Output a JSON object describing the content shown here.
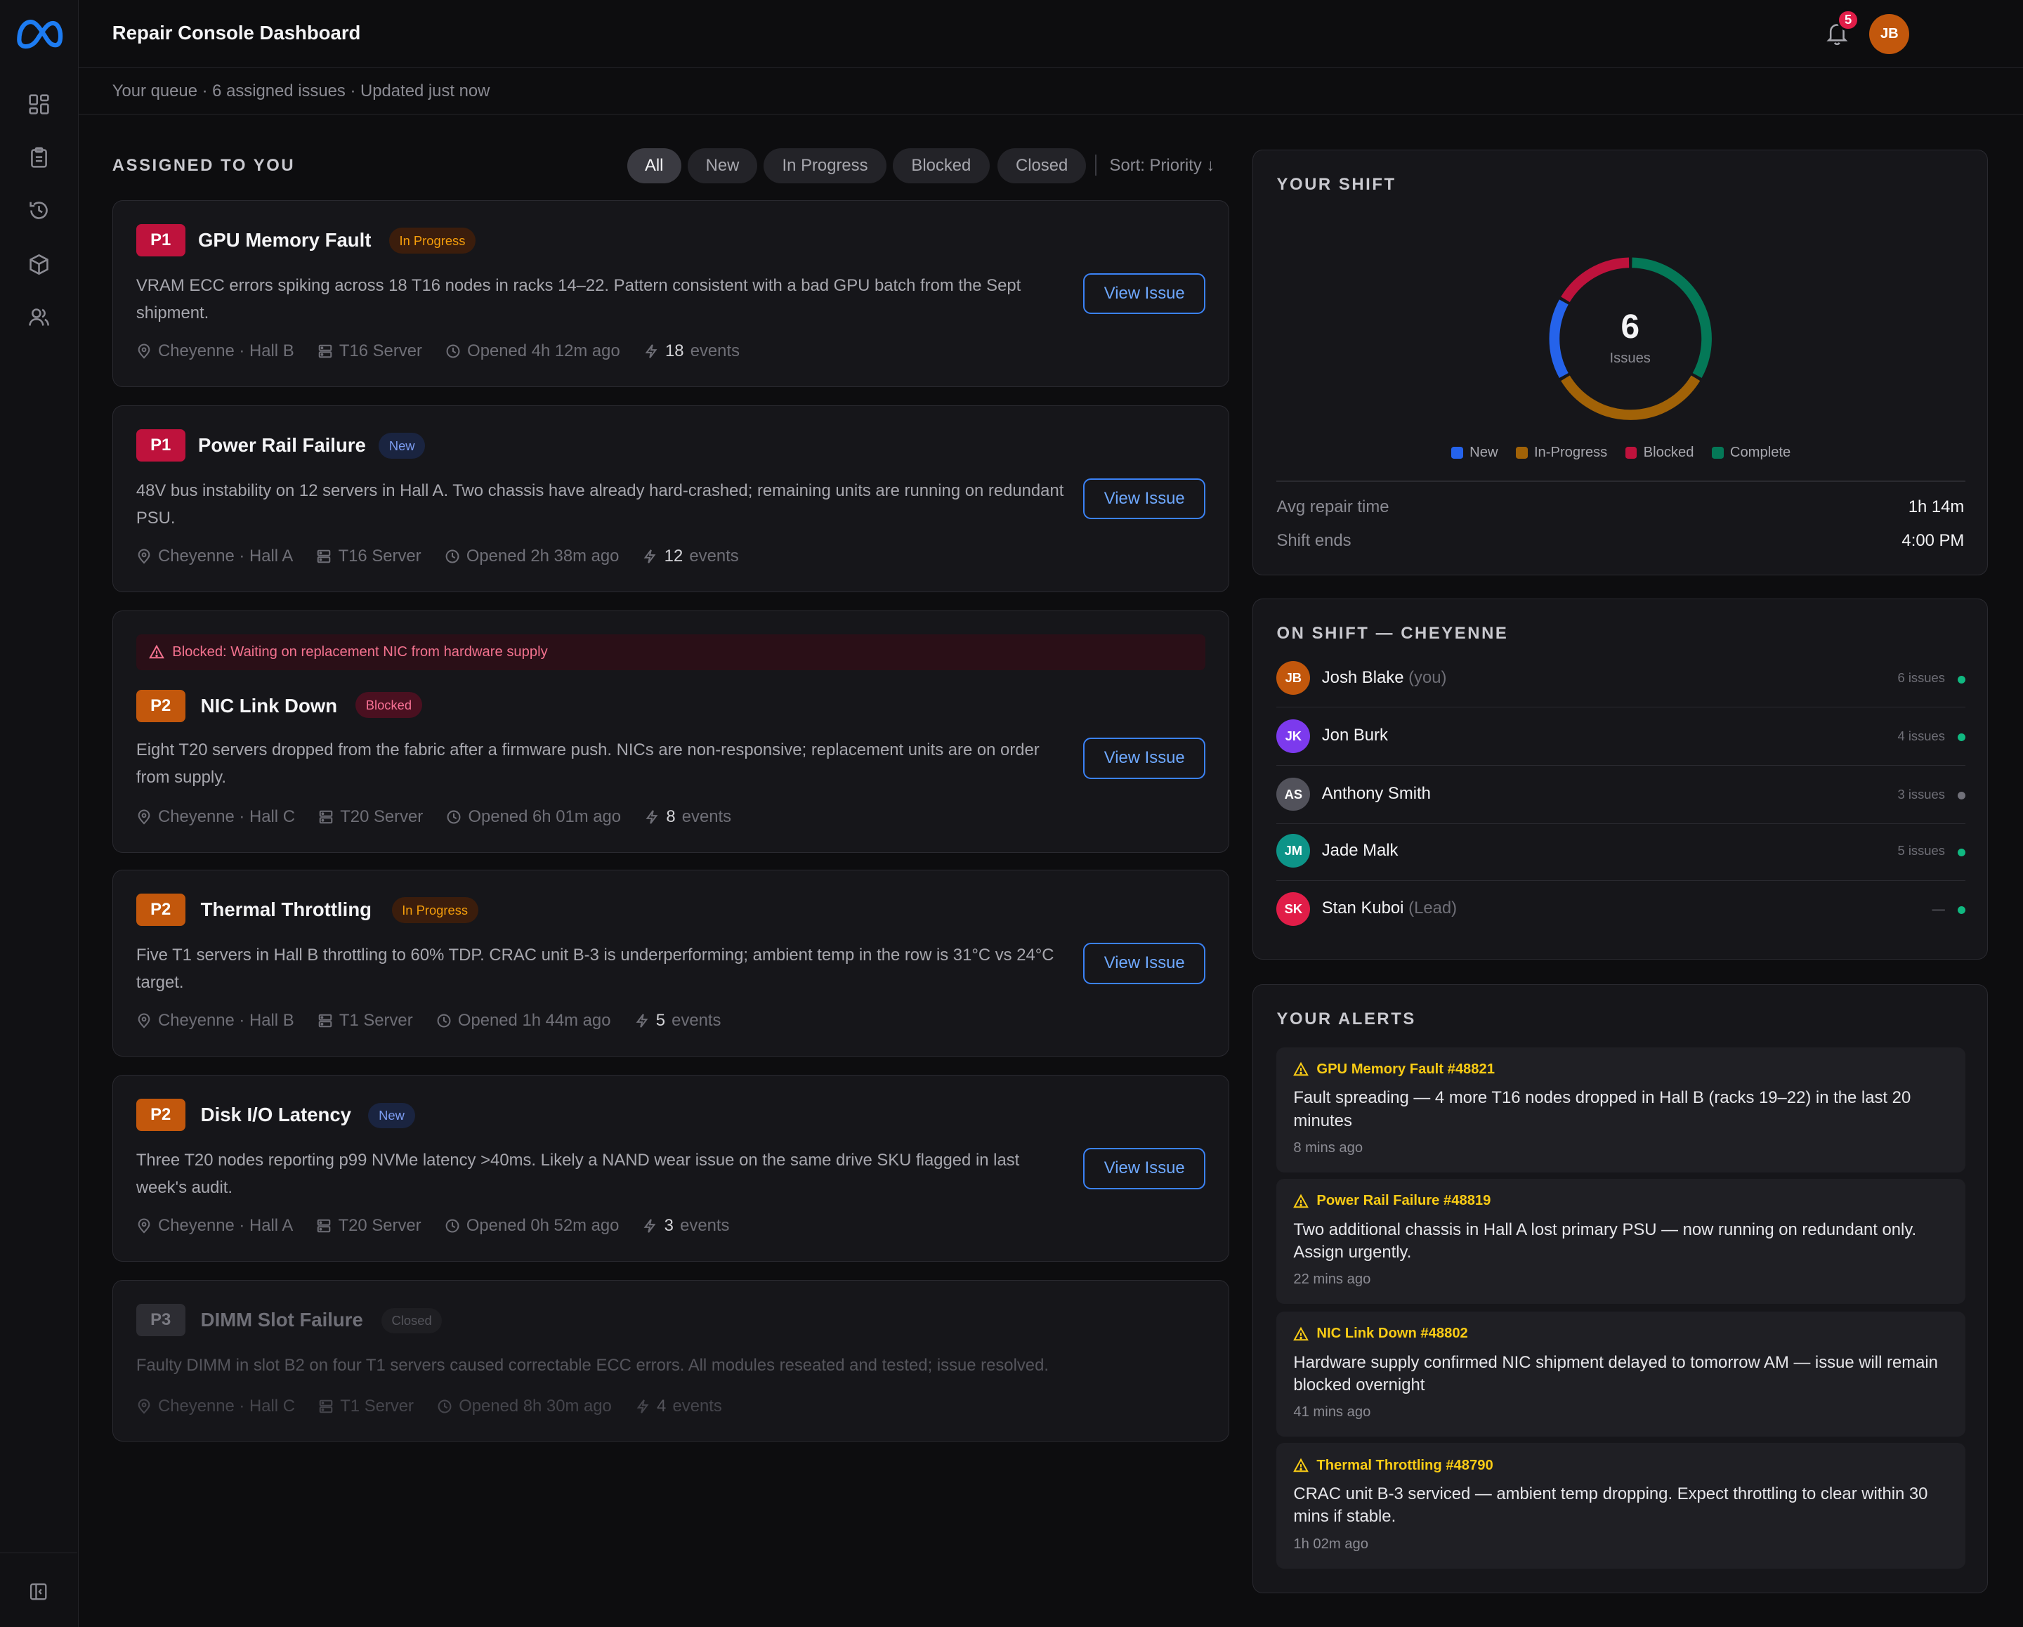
{
  "app": {
    "title": "Repair Console Dashboard",
    "subtitle": "Your queue · 6 assigned issues · Updated just now",
    "notification_count": "5",
    "user_initials": "JB"
  },
  "sidebar": {
    "items": [
      {
        "icon": "dashboard-icon"
      },
      {
        "icon": "clipboard-icon"
      },
      {
        "icon": "history-icon"
      },
      {
        "icon": "package-icon"
      },
      {
        "icon": "users-icon"
      }
    ]
  },
  "issues": {
    "section_title": "ASSIGNED TO YOU",
    "filters": [
      "All",
      "New",
      "In Progress",
      "Blocked",
      "Closed"
    ],
    "active_filter": "All",
    "sort_label": "Sort: Priority ↓",
    "view_label": "View Issue",
    "events_word": "events",
    "list": [
      {
        "priority": "P1",
        "title": "GPU Memory Fault",
        "status": "In Progress",
        "description": "VRAM ECC errors spiking across 18 T16 nodes in racks 14–22. Pattern consistent with a bad GPU batch from the Sept shipment.",
        "location": "Cheyenne · Hall B",
        "server": "T16 Server",
        "opened": "Opened 4h 12m ago",
        "events": "18"
      },
      {
        "priority": "P1",
        "title": "Power Rail Failure",
        "status": "New",
        "description": "48V bus instability on 12 servers in Hall A. Two chassis have already hard-crashed; remaining units are running on redundant PSU.",
        "location": "Cheyenne · Hall A",
        "server": "T16 Server",
        "opened": "Opened 2h 38m ago",
        "events": "12"
      },
      {
        "priority": "P2",
        "title": "NIC Link Down",
        "status": "Blocked",
        "blocked_note": "Blocked: Waiting on replacement NIC from hardware supply",
        "description": "Eight T20 servers dropped from the fabric after a firmware push. NICs are non-responsive; replacement units are on order from supply.",
        "location": "Cheyenne · Hall C",
        "server": "T20 Server",
        "opened": "Opened 6h 01m ago",
        "events": "8"
      },
      {
        "priority": "P2",
        "title": "Thermal Throttling",
        "status": "In Progress",
        "description": "Five T1 servers in Hall B throttling to 60% TDP. CRAC unit B-3 is underperforming; ambient temp in the row is 31°C vs 24°C target.",
        "location": "Cheyenne · Hall B",
        "server": "T1 Server",
        "opened": "Opened 1h 44m ago",
        "events": "5"
      },
      {
        "priority": "P2",
        "title": "Disk I/O Latency",
        "status": "New",
        "description": "Three T20 nodes reporting p99 NVMe latency >40ms. Likely a NAND wear issue on the same drive SKU flagged in last week's audit.",
        "location": "Cheyenne · Hall A",
        "server": "T20 Server",
        "opened": "Opened 0h 52m ago",
        "events": "3"
      },
      {
        "priority": "P3",
        "title": "DIMM Slot Failure",
        "status": "Closed",
        "description": "Faulty DIMM in slot B2 on four T1 servers caused correctable ECC errors. All modules reseated and tested; issue resolved.",
        "location": "Cheyenne · Hall C",
        "server": "T1 Server",
        "opened": "Opened 8h 30m ago",
        "events": "4"
      }
    ]
  },
  "shift": {
    "title": "YOUR SHIFT",
    "total": "6",
    "total_label": "Issues",
    "segments": [
      {
        "name": "New",
        "value": 1,
        "color": "#2563eb"
      },
      {
        "name": "In-Progress",
        "value": 2,
        "color": "#a16207"
      },
      {
        "name": "Blocked",
        "value": 1,
        "color": "#be123c"
      },
      {
        "name": "Complete",
        "value": 2,
        "color": "#047857"
      }
    ],
    "avg_label": "Avg repair time",
    "avg_value": "1h 14m",
    "ends_label": "Shift ends",
    "ends_value": "4:00 PM"
  },
  "team": {
    "title": "ON SHIFT — CHEYENNE",
    "members": [
      {
        "initials": "JB",
        "name": "Josh Blake",
        "tag": "(you)",
        "issues": "6 issues",
        "color": "#c2570c",
        "dot": "#10b981"
      },
      {
        "initials": "JK",
        "name": "Jon Burk",
        "tag": "",
        "issues": "4 issues",
        "color": "#7c3aed",
        "dot": "#10b981"
      },
      {
        "initials": "AS",
        "name": "Anthony Smith",
        "tag": "",
        "issues": "3 issues",
        "color": "#52525b",
        "dot": "#71717a"
      },
      {
        "initials": "JM",
        "name": "Jade Malk",
        "tag": "",
        "issues": "5 issues",
        "color": "#0d9488",
        "dot": "#10b981"
      },
      {
        "initials": "SK",
        "name": "Stan Kuboi",
        "tag": "(Lead)",
        "issues": "—",
        "color": "#e11d48",
        "dot": "#10b981"
      }
    ]
  },
  "alerts": {
    "title": "YOUR ALERTS",
    "list": [
      {
        "head": "GPU Memory Fault #48821",
        "text": "Fault spreading — 4 more T16 nodes dropped in Hall B (racks 19–22) in the last 20 minutes",
        "time": "8 mins ago"
      },
      {
        "head": "Power Rail Failure #48819",
        "text": "Two additional chassis in Hall A lost primary PSU — now running on redundant only. Assign urgently.",
        "time": "22 mins ago"
      },
      {
        "head": "NIC Link Down #48802",
        "text": "Hardware supply confirmed NIC shipment delayed to tomorrow AM — issue will remain blocked overnight",
        "time": "41 mins ago"
      },
      {
        "head": "Thermal Throttling #48790",
        "text": "CRAC unit B-3 serviced — ambient temp dropping. Expect throttling to clear within 30 mins if stable.",
        "time": "1h 02m ago"
      }
    ]
  }
}
